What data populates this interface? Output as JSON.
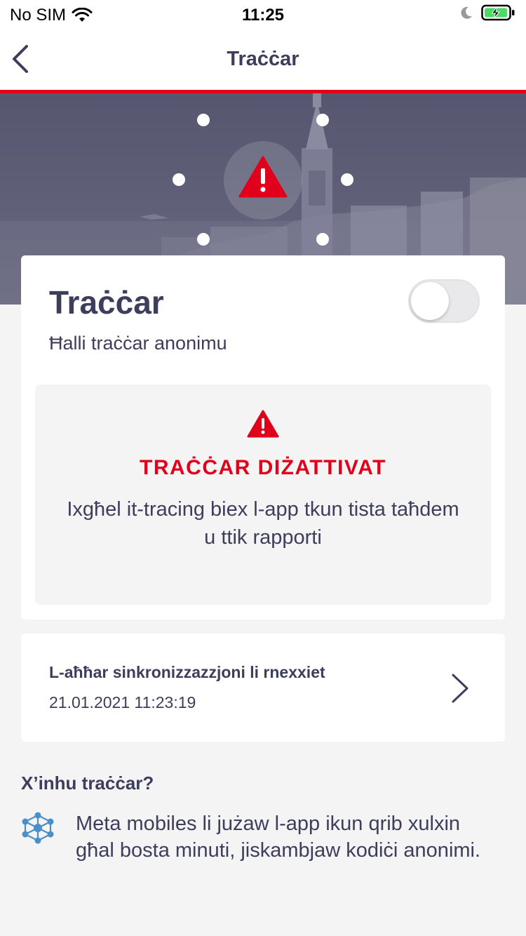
{
  "status_bar": {
    "carrier": "No SIM",
    "time": "11:25",
    "icons": [
      "wifi-icon",
      "moon-icon",
      "battery-charging-icon"
    ]
  },
  "nav": {
    "title": "Traċċar",
    "back_icon": "chevron-left-icon"
  },
  "colors": {
    "accent_red": "#e1001b",
    "text_dark": "#3d3d5c",
    "hero_bg": "#5e5e77",
    "background": "#f4f4f4",
    "info_icon_blue": "#4a90c8"
  },
  "hero": {
    "icon": "warning-icon"
  },
  "tracing_card": {
    "title": "Traċċar",
    "subtitle": "Ħalli traċċar anonimu",
    "toggle_on": false,
    "status": {
      "icon": "warning-icon",
      "title": "TRAĊĊAR DIŻATTIVAT",
      "description": "Ixgħel it-tracing biex l-app tkun tista taħdem u ttik rapporti"
    }
  },
  "sync_card": {
    "label": "L-aħħar sinkronizzazzjoni li rnexxiet",
    "value": "21.01.2021 11:23:19",
    "chevron_icon": "chevron-right-icon"
  },
  "info": {
    "heading": "X’inhu traċċar?",
    "icon": "network-icon",
    "text": "Meta mobiles li jużaw l-app ikun qrib xulxin għal bosta minuti, jiskambjaw kodiċi anonimi."
  }
}
